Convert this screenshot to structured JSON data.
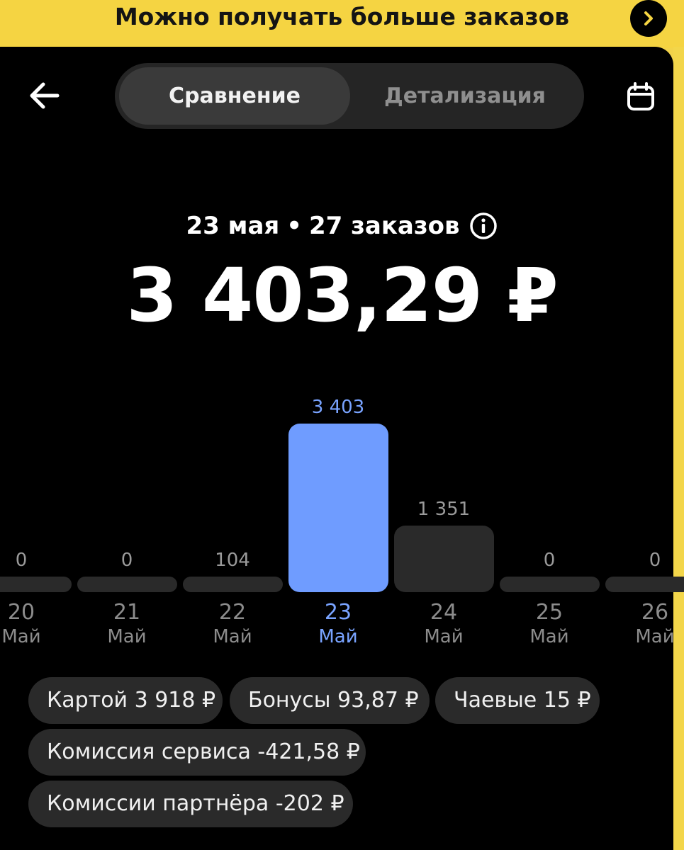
{
  "banner": {
    "text": "Можно получать больше заказов"
  },
  "tabs": [
    {
      "label": "Сравнение",
      "active": true
    },
    {
      "label": "Детализация",
      "active": false
    }
  ],
  "summary": {
    "date": "23 мая",
    "separator": "•",
    "orders": "27 заказов",
    "total": "3 403,29 ₽"
  },
  "chart_data": {
    "type": "bar",
    "categories": [
      "20",
      "21",
      "22",
      "23",
      "24",
      "25",
      "26"
    ],
    "months": [
      "Май",
      "Май",
      "Май",
      "Май",
      "Май",
      "Май",
      "Май"
    ],
    "values": [
      0,
      0,
      104,
      3403,
      1351,
      0,
      0
    ],
    "labels": [
      "0",
      "0",
      "104",
      "3 403",
      "1 351",
      "0",
      "0"
    ],
    "selected_index": 3,
    "colors": {
      "bar": "#2a2a2a",
      "selected": "#6f9cff"
    }
  },
  "chips": [
    "Картой 3 918 ₽",
    "Бонусы 93,87 ₽",
    "Чаевые 15 ₽",
    "Комиссия сервиса -421,58 ₽",
    "Комиссии партнёра -202 ₽"
  ]
}
